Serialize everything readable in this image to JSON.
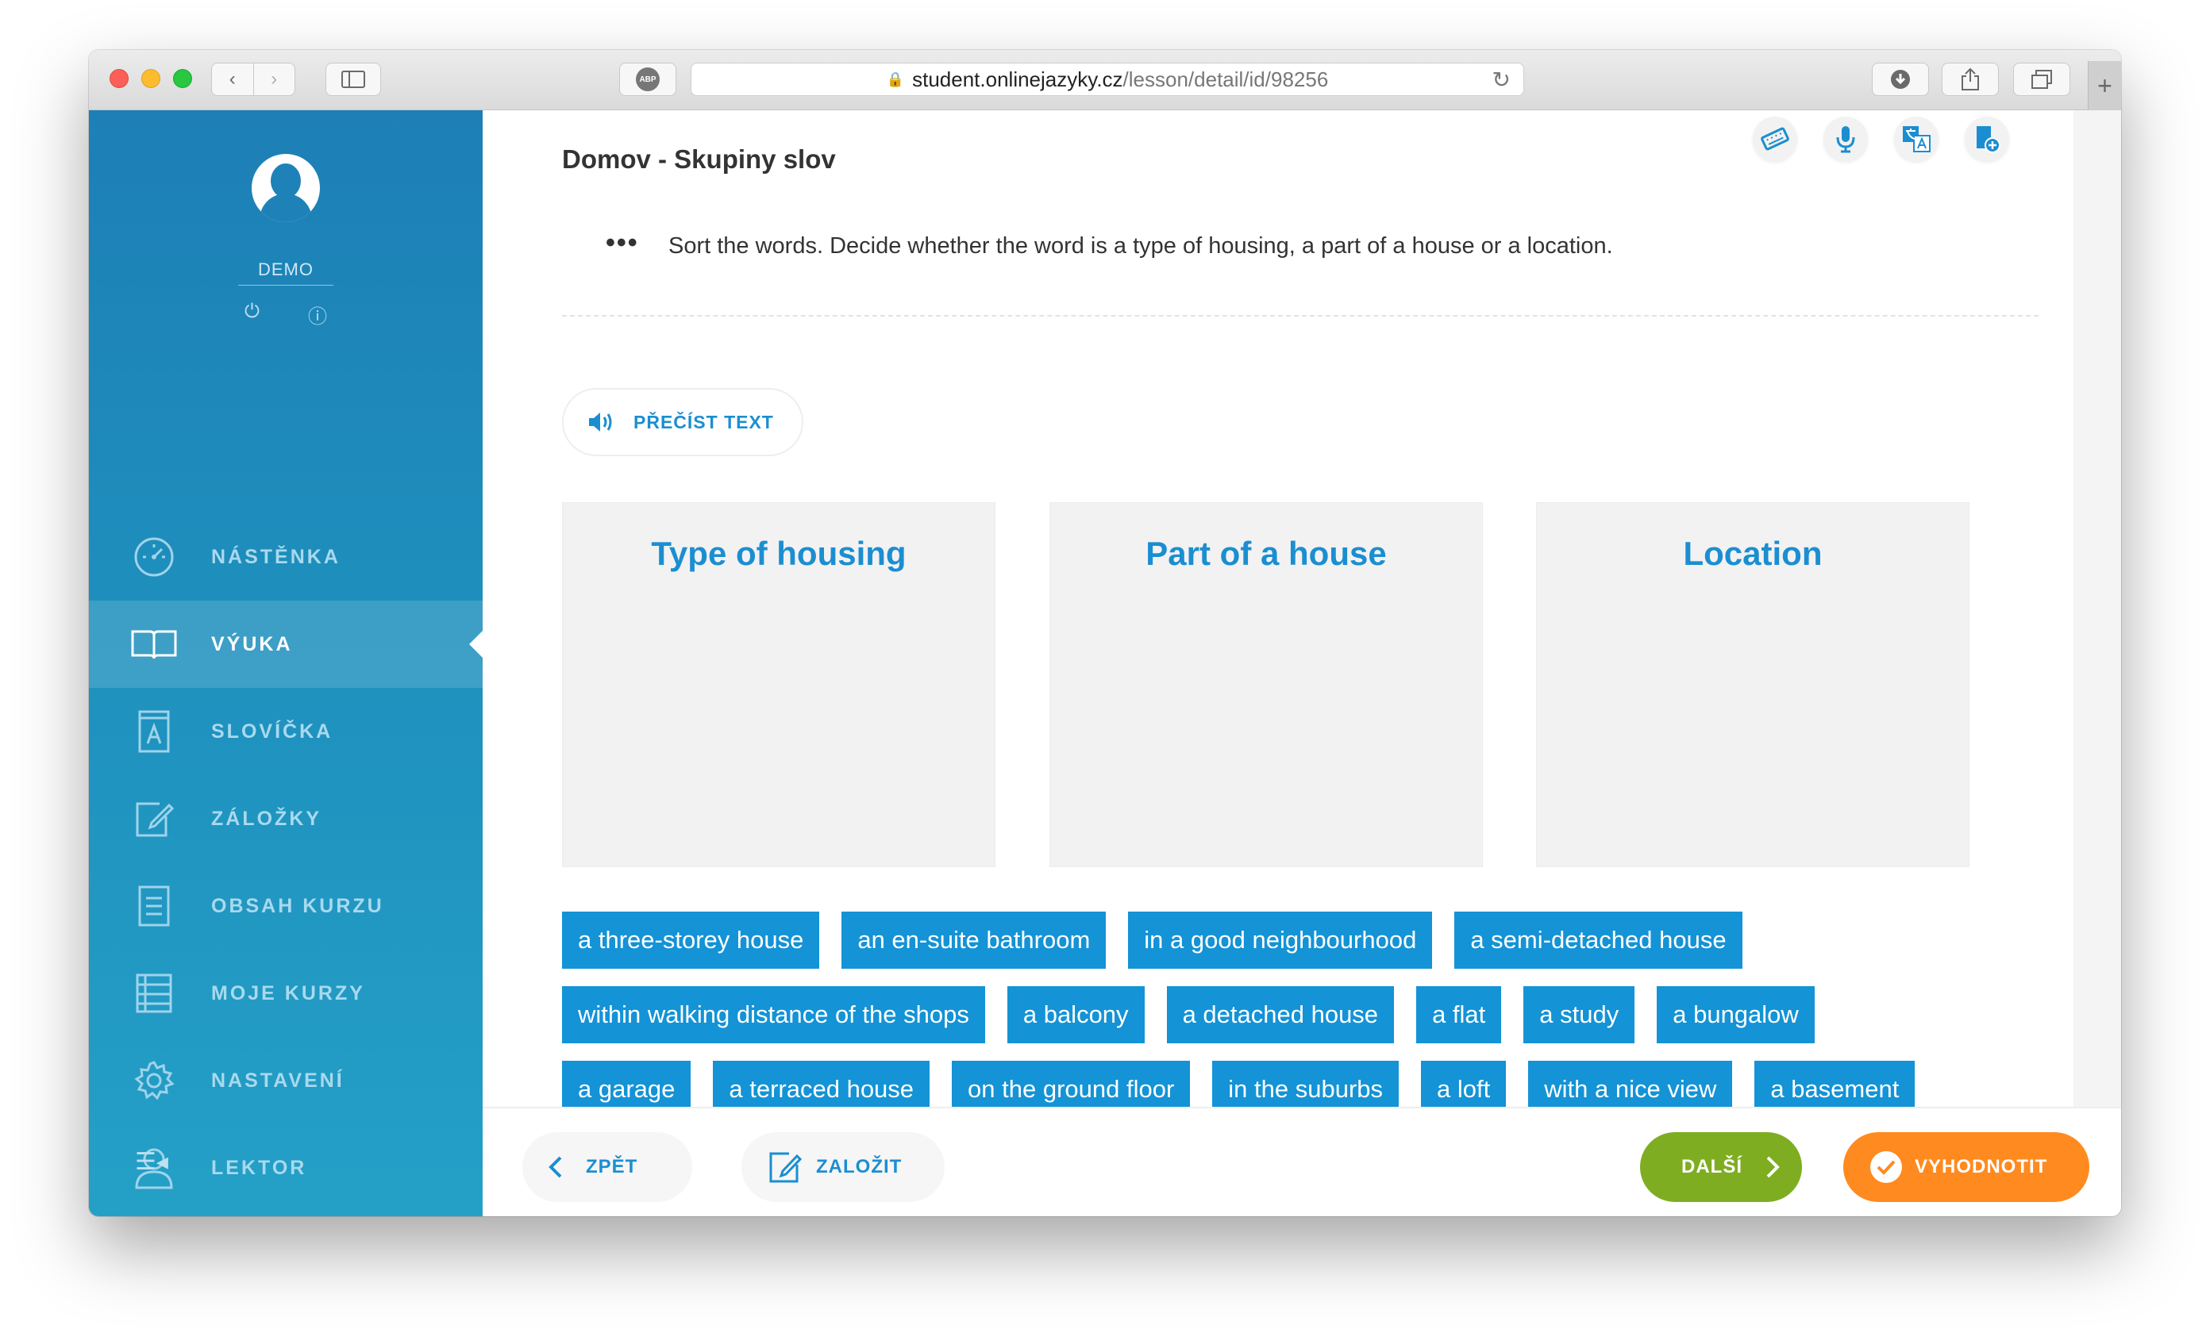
{
  "browser": {
    "url_domain": "student.onlinejazyky.cz",
    "url_path": "/lesson/detail/id/98256",
    "abp_label": "ABP"
  },
  "sidebar": {
    "username": "DEMO",
    "items": [
      {
        "label": "NÁSTĚNKA",
        "icon": "dashboard-icon",
        "active": false
      },
      {
        "label": "VÝUKA",
        "icon": "book-icon",
        "active": true
      },
      {
        "label": "SLOVÍČKA",
        "icon": "vocabulary-icon",
        "active": false
      },
      {
        "label": "ZÁLOŽKY",
        "icon": "edit-note-icon",
        "active": false
      },
      {
        "label": "OBSAH KURZU",
        "icon": "document-icon",
        "active": false
      },
      {
        "label": "MOJE KURZY",
        "icon": "list-icon",
        "active": false
      },
      {
        "label": "NASTAVENÍ",
        "icon": "gear-icon",
        "active": false
      },
      {
        "label": "LEKTOR",
        "icon": "person-icon",
        "active": false
      }
    ]
  },
  "lesson": {
    "title": "Domov - Skupiny slov",
    "instructions": "Sort the words. Decide whether the word is a type of housing, a part of a house or a location.",
    "read_text_label": "PŘEČÍST TEXT",
    "tools": [
      "keyboard-icon",
      "microphone-icon",
      "translate-icon",
      "add-bookmark-icon"
    ]
  },
  "buckets": [
    {
      "title": "Type of housing"
    },
    {
      "title": "Part of a house"
    },
    {
      "title": "Location"
    }
  ],
  "words": [
    [
      "a three-storey house",
      "an en-suite bathroom",
      "in a good neighbourhood",
      "a semi-detached house"
    ],
    [
      "within walking distance of the shops",
      "a balcony",
      "a detached house",
      "a flat",
      "a study",
      "a bungalow"
    ],
    [
      "a garage",
      "a terraced house",
      "on the ground floor",
      "in the suburbs",
      "a loft",
      "with a nice view",
      "a basement"
    ]
  ],
  "footer": {
    "back_label": "ZPĚT",
    "bookmark_label": "ZALOŽIT",
    "next_label": "DALŠÍ",
    "evaluate_label": "VYHODNOTIT"
  },
  "colors": {
    "accent": "#1b8ed1",
    "chip": "#1493d6",
    "next": "#7fad22",
    "evaluate": "#ff8a1f"
  }
}
